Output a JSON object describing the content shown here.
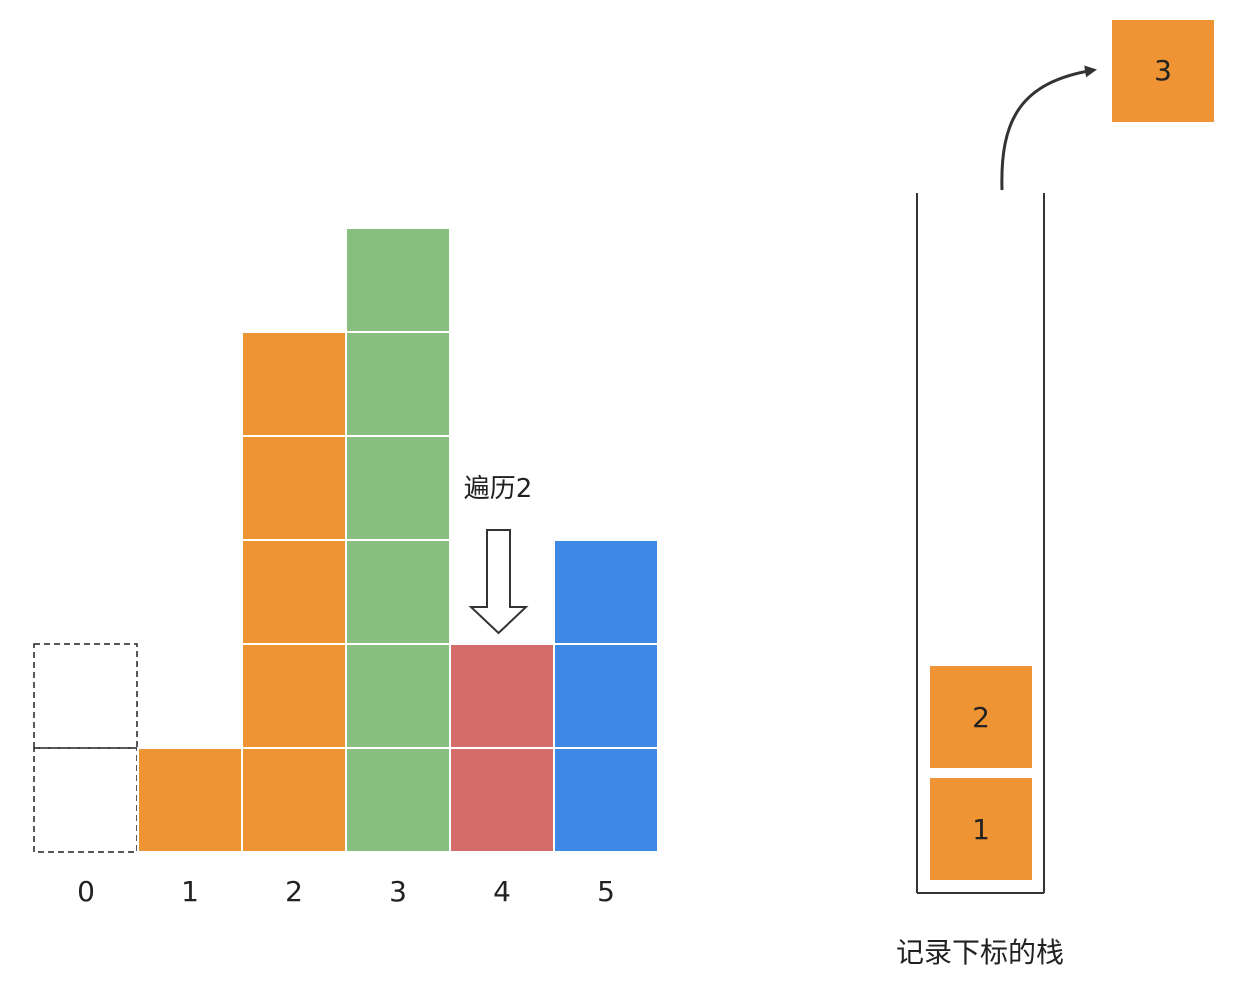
{
  "colors": {
    "orange": "#ee9434",
    "green": "#88bf80",
    "red": "#d46c69",
    "blue": "#3f89e6",
    "stroke": "#222222",
    "grid_line": "#ffffff"
  },
  "bars": [
    {
      "index_label": "0",
      "height": 2,
      "style": "dashed-empty"
    },
    {
      "index_label": "1",
      "height": 1,
      "color_key": "orange"
    },
    {
      "index_label": "2",
      "height": 5,
      "color_key": "orange"
    },
    {
      "index_label": "3",
      "height": 6,
      "color_key": "green"
    },
    {
      "index_label": "4",
      "height": 2,
      "color_key": "red"
    },
    {
      "index_label": "5",
      "height": 3,
      "color_key": "blue"
    }
  ],
  "pointer": {
    "label": "遍历2",
    "points_to_index": 4,
    "icon": "hollow-down-arrow-icon"
  },
  "stack": {
    "caption": "记录下标的栈",
    "items": [
      "1",
      "2"
    ],
    "popped_item": "3",
    "popped_icon": "curved-arrow-icon"
  }
}
